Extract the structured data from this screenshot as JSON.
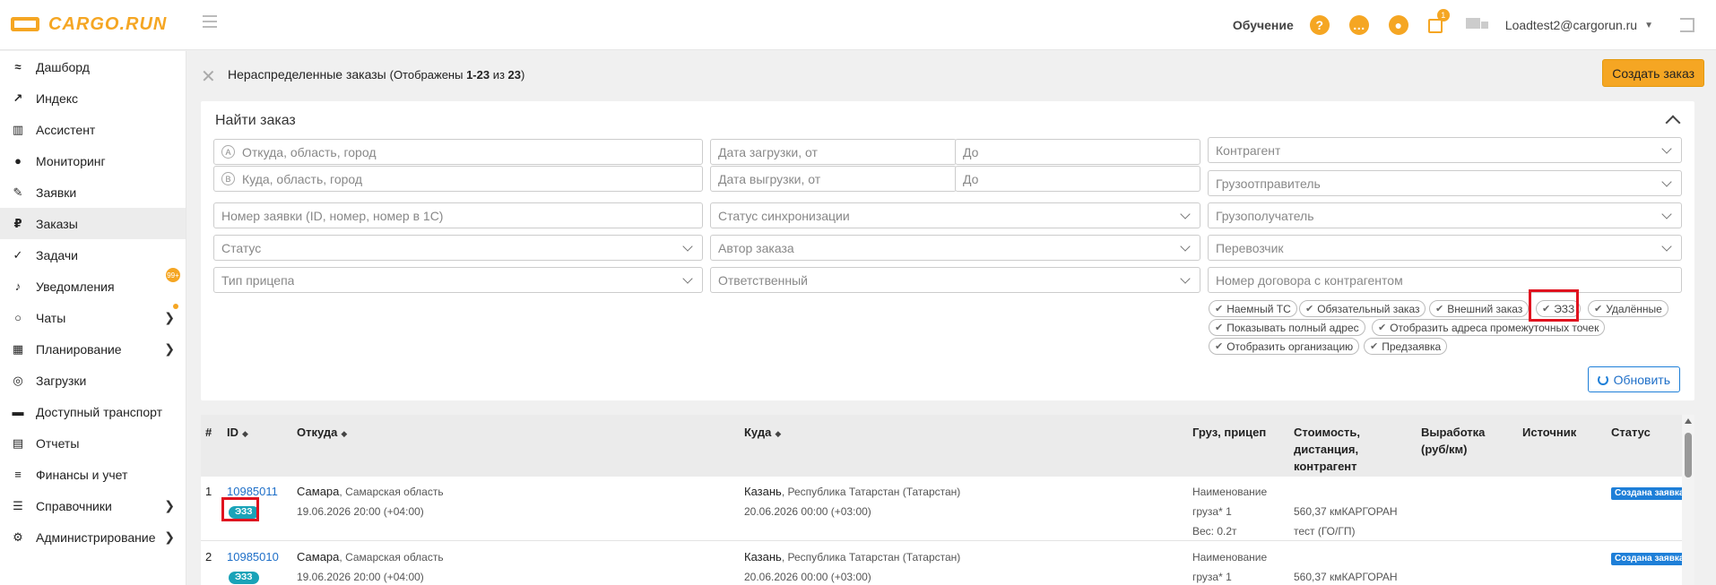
{
  "header": {
    "logo_text": "CARGO.RUN",
    "training": "Обучение",
    "help_glyph": "?",
    "notif_count": "1",
    "user": "Loadtest2@cargorun.ru"
  },
  "sidebar": {
    "items": [
      {
        "label": "Дашборд"
      },
      {
        "label": "Индекс"
      },
      {
        "label": "Ассистент"
      },
      {
        "label": "Мониторинг"
      },
      {
        "label": "Заявки"
      },
      {
        "label": "Заказы"
      },
      {
        "label": "Задачи"
      },
      {
        "label": "Уведомления",
        "badge": "99+"
      },
      {
        "label": "Чаты"
      },
      {
        "label": "Планирование"
      },
      {
        "label": "Загрузки"
      },
      {
        "label": "Доступный транспорт"
      },
      {
        "label": "Отчеты"
      },
      {
        "label": "Финансы и учет"
      },
      {
        "label": "Справочники"
      },
      {
        "label": "Администрирование"
      }
    ],
    "rouble_glyph": "₽"
  },
  "page": {
    "title": "Нераспределенные заказы",
    "shown_prefix": "(Отображены ",
    "shown_range": "1-23",
    "shown_of": " из ",
    "shown_total": "23",
    "shown_suffix": ")",
    "create_button": "Создать заказ"
  },
  "search": {
    "title": "Найти заказ",
    "from_marker": "A",
    "to_marker": "B",
    "from_placeholder": "Откуда, область, город",
    "to_placeholder": "Куда, область, город",
    "load_date_from": "Дата загрузки, от",
    "load_date_to": "До",
    "unload_date_from": "Дата выгрузки, от",
    "unload_date_to": "До",
    "counterparty": "Контрагент",
    "shipper": "Грузоотправитель",
    "consignee": "Грузополучатель",
    "carrier": "Перевозчик",
    "contract_number": "Номер договора с контрагентом",
    "order_number": "Номер заявки (ID, номер, номер в 1С)",
    "sync_status": "Статус синхронизации",
    "status": "Статус",
    "order_author": "Автор заказа",
    "trailer_type": "Тип прицепа",
    "responsible": "Ответственный",
    "chips": [
      "Наемный ТС",
      "Обязательный заказ",
      "Внешний заказ",
      "ЭЗЗ",
      "Удалённые",
      "Показывать полный адрес",
      "Отобразить адреса промежуточных точек",
      "Отобразить организацию",
      "Предзаявка"
    ],
    "refresh_button": "Обновить"
  },
  "table": {
    "headers": {
      "num": "#",
      "id": "ID",
      "from": "Откуда",
      "to": "Куда",
      "cargo_l1": "Груз, прицеп",
      "cost_l1": "Стоимость,",
      "cost_l2": "дистанция,",
      "cost_l3": "контрагент",
      "output_l1": "Выработка",
      "output_l2": "(руб/км)",
      "source": "Источник",
      "status": "Статус"
    },
    "rows": [
      {
        "num": "1",
        "id": "10985011",
        "tag": "ЭЗЗ",
        "from_city": "Самара",
        "from_region": ", Самарская область",
        "from_date": "19.06.2026 20:00 (+04:00)",
        "to_city": "Казань",
        "to_region": ", Республика Татарстан (Татарстан)",
        "to_date": "20.06.2026 00:00 (+03:00)",
        "cargo_l1": "Наименование",
        "cargo_l2": "груза* 1",
        "cargo_l3": "Вес: 0.2т",
        "cost_l1": "560,37 кмКАРГОРАН",
        "cost_l2": "тест (ГО/ГП)",
        "status": "Создана заявка"
      },
      {
        "num": "2",
        "id": "10985010",
        "tag": "ЭЗЗ",
        "from_city": "Самара",
        "from_region": ", Самарская область",
        "from_date": "19.06.2026 20:00 (+04:00)",
        "to_city": "Казань",
        "to_region": ", Республика Татарстан (Татарстан)",
        "to_date": "20.06.2026 00:00 (+03:00)",
        "cargo_l1": "Наименование",
        "cargo_l2": "груза* 1",
        "cargo_l3": "",
        "cost_l1": "560,37 кмКАРГОРАН",
        "cost_l2": "",
        "status": "Создана заявка"
      }
    ]
  },
  "colors": {
    "accent": "#f5a623",
    "link": "#1e6fc8",
    "tag": "#1aa3b8",
    "status": "#1e7fd8",
    "highlight": "#e0131f"
  }
}
